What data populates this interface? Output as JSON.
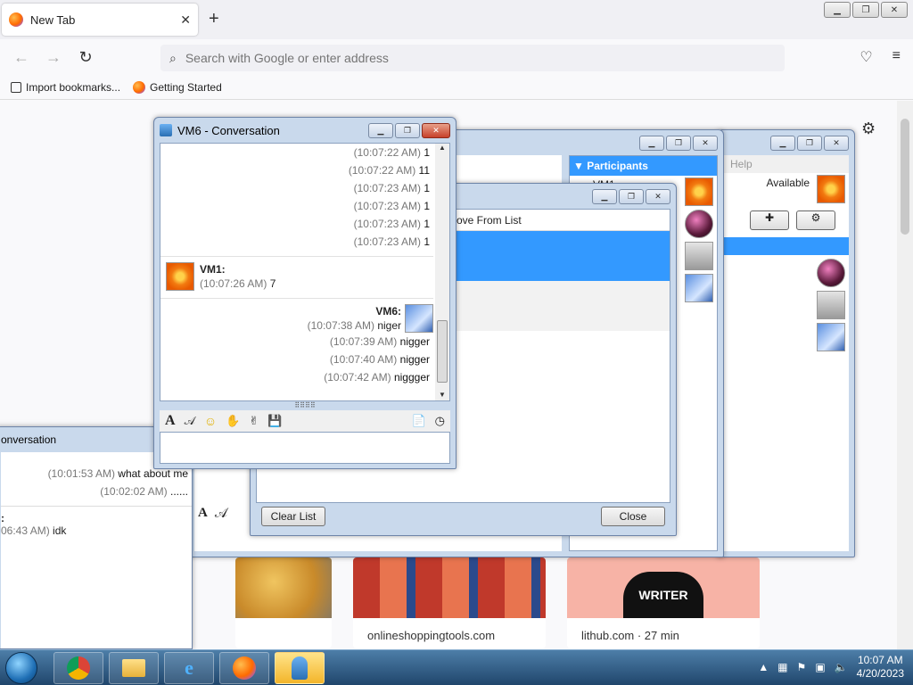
{
  "browser": {
    "tab_title": "New Tab",
    "address_placeholder": "Search with Google or enter address",
    "bookmarks": [
      {
        "label": "Import bookmarks...",
        "icon": "import-icon"
      },
      {
        "label": "Getting Started",
        "icon": "firefox-icon"
      }
    ],
    "tiles": [
      {
        "label": ""
      },
      {
        "label": "onlineshoppingtools.com"
      },
      {
        "label": "lithub.com · 27 min",
        "image_text": "WRITER"
      }
    ]
  },
  "conversation": {
    "title": "VM6 - Conversation",
    "top_lines": [
      {
        "ts": "(10:07:22 AM)",
        "text": "1"
      },
      {
        "ts": "(10:07:22 AM)",
        "text": "11"
      },
      {
        "ts": "(10:07:23 AM)",
        "text": "1"
      },
      {
        "ts": "(10:07:23 AM)",
        "text": "1"
      },
      {
        "ts": "(10:07:23 AM)",
        "text": "1"
      },
      {
        "ts": "(10:07:23 AM)",
        "text": "1"
      }
    ],
    "vm1_block": {
      "name": "VM1:",
      "ts": "(10:07:26 AM)",
      "text": "7"
    },
    "vm6_block": {
      "name": "VM6:",
      "lines": [
        {
          "ts": "(10:07:38 AM)",
          "text": "niger"
        },
        {
          "ts": "(10:07:39 AM)",
          "text": "nigger"
        },
        {
          "ts": "(10:07:40 AM)",
          "text": "nigger"
        },
        {
          "ts": "(10:07:42 AM)",
          "text": "niggger"
        }
      ]
    },
    "input_value": ""
  },
  "left_conversation": {
    "title": "onversation",
    "lines": [
      {
        "ts": "(10:01:53 AM)",
        "text": "what about me"
      },
      {
        "ts": "(10:02:02 AM)",
        "text": "......"
      }
    ],
    "other": {
      "name": ":",
      "ts": "06:43 AM)",
      "text": "idk"
    }
  },
  "group_window": {
    "participants_header": "Participants",
    "participant_first": "VM1"
  },
  "list_window": {
    "column_label": "ove From List",
    "clear_button": "Clear List",
    "close_button": "Close"
  },
  "contacts_window": {
    "menu_help": "Help",
    "status": "Available"
  },
  "taskbar": {
    "time": "10:07 AM",
    "date": "4/20/2023"
  }
}
